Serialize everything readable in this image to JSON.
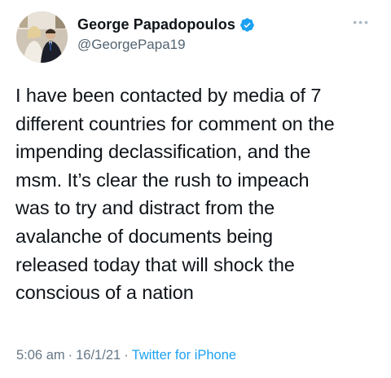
{
  "user": {
    "display_name": "George Papadopoulos",
    "handle": "@GeorgePapa19",
    "verified_icon": "verified-badge-icon",
    "verified_color": "#1da1f2"
  },
  "tweet": {
    "lines": [
      "I have been contacted by media of 7",
      "different countries for comment on the",
      "impending declassification, and the",
      "msm. It’s clear the rush to impeach",
      "was to try and distract from the",
      "avalanche of documents being",
      "released today that will shock the",
      "conscious of a nation"
    ],
    "time": "5:06 am",
    "date": "16/1/21",
    "separator": "·",
    "source": "Twitter for iPhone"
  },
  "menu": {
    "more_label": "•••"
  }
}
